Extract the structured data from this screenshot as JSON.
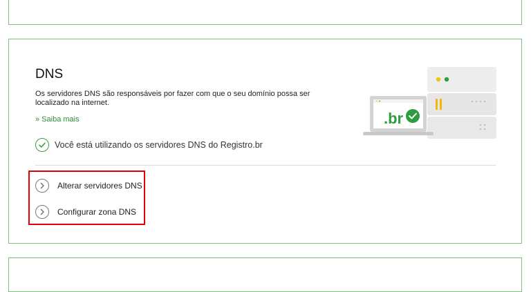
{
  "dns": {
    "title": "DNS",
    "description": "Os servidores DNS são responsáveis por fazer com que o seu domínio possa ser localizado na internet.",
    "more_link": "» Saiba mais",
    "status_text": "Você está utilizando os servidores DNS do Registro.br",
    "actions": [
      {
        "label": "Alterar servidores DNS"
      },
      {
        "label": "Configurar zona DNS"
      }
    ]
  },
  "illustration": {
    "laptop_text": ".br",
    "icon": "laptop-servers-illustration"
  },
  "colors": {
    "accent": "#2e8b3a",
    "card_border": "#7fbf7f",
    "highlight": "#e30000"
  }
}
